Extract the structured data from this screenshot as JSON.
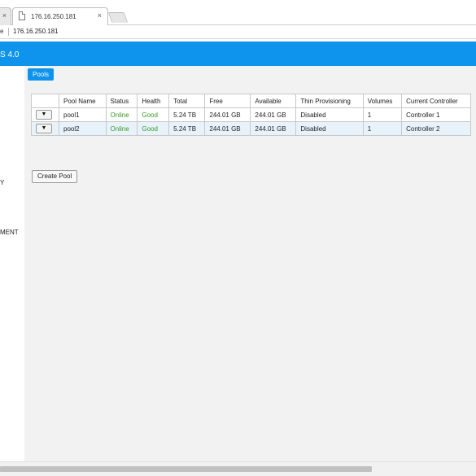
{
  "browser": {
    "prev_tab_close": "×",
    "active_tab_title": "176.16.250.181",
    "active_tab_close": "×",
    "address_prefix": "e",
    "address_url": "176.16.250.181"
  },
  "app": {
    "title": "S 4.0",
    "accent_color": "#0f94ee"
  },
  "sidebar": {
    "items": [
      {
        "label": "Y"
      },
      {
        "label": "MENT"
      }
    ]
  },
  "main": {
    "active_tab": "Pools",
    "table": {
      "columns": [
        "",
        "Pool Name",
        "Status",
        "Health",
        "Total",
        "Free",
        "Available",
        "Thin Provisioning",
        "Volumes",
        "Current Controller"
      ],
      "rows": [
        {
          "menu": "▼",
          "name": "pool1",
          "status": "Online",
          "health": "Good",
          "total": "5.24 TB",
          "free": "244.01 GB",
          "available": "244.01 GB",
          "thin": "Disabled",
          "volumes": "1",
          "controller": "Controller 1"
        },
        {
          "menu": "▼",
          "name": "pool2",
          "status": "Online",
          "health": "Good",
          "total": "5.24 TB",
          "free": "244.01 GB",
          "available": "244.01 GB",
          "thin": "Disabled",
          "volumes": "1",
          "controller": "Controller 2"
        }
      ]
    },
    "create_button": "Create Pool"
  }
}
